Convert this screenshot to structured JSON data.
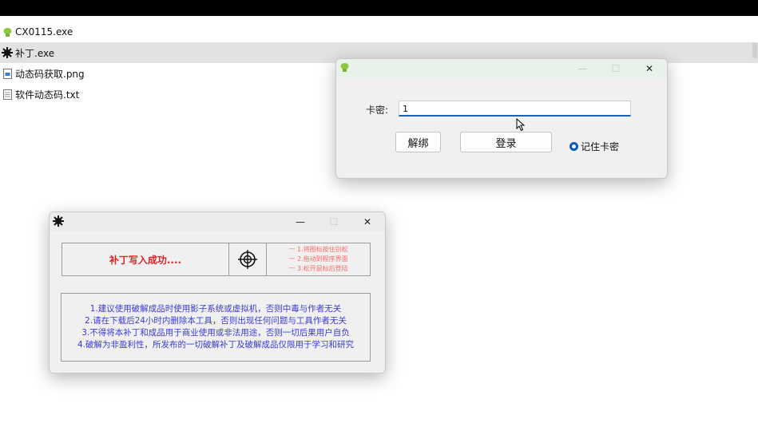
{
  "files": [
    {
      "name": "CX0115.exe",
      "icon": "app-green-icon",
      "selected": false
    },
    {
      "name": "补丁.exe",
      "icon": "gear-app-icon",
      "selected": true
    },
    {
      "name": "动态码获取.png",
      "icon": "image-file-icon",
      "selected": false
    },
    {
      "name": "软件动态码.txt",
      "icon": "text-file-icon",
      "selected": false
    }
  ],
  "login_window": {
    "card_label": "卡密:",
    "card_value": "1",
    "unbind_label": "解绑",
    "login_label": "登录",
    "remember_label": "记住卡密",
    "remember_checked": true,
    "minimize_glyph": "—",
    "maximize_glyph": "☐",
    "close_glyph": "✕"
  },
  "patch_window": {
    "success_text": "补丁写入成功....",
    "steps": [
      "一 1.将图标按住别松",
      "一 2.拖动到程序界面",
      "一 3.松开鼠标后登陆"
    ],
    "notes": [
      "1.建议使用破解成品时使用影子系统或虚拟机，否则中毒与作者无关",
      "2.请在下载后24小时内删除本工具，否则出现任何问题与工具作者无关",
      "3.不得将本补丁和成品用于商业使用或非法用途，否则一切后果用户自负",
      "4.破解为非盈利性，所发布的一切破解补丁及破解成品仅限用于学习和研究"
    ],
    "minimize_glyph": "—",
    "maximize_glyph": "☐",
    "close_glyph": "✕"
  },
  "colors": {
    "accent_blue": "#1f5fb8",
    "success_red": "#e02424",
    "step_red": "#ff6a6a",
    "note_blue": "#3b3bd6"
  }
}
